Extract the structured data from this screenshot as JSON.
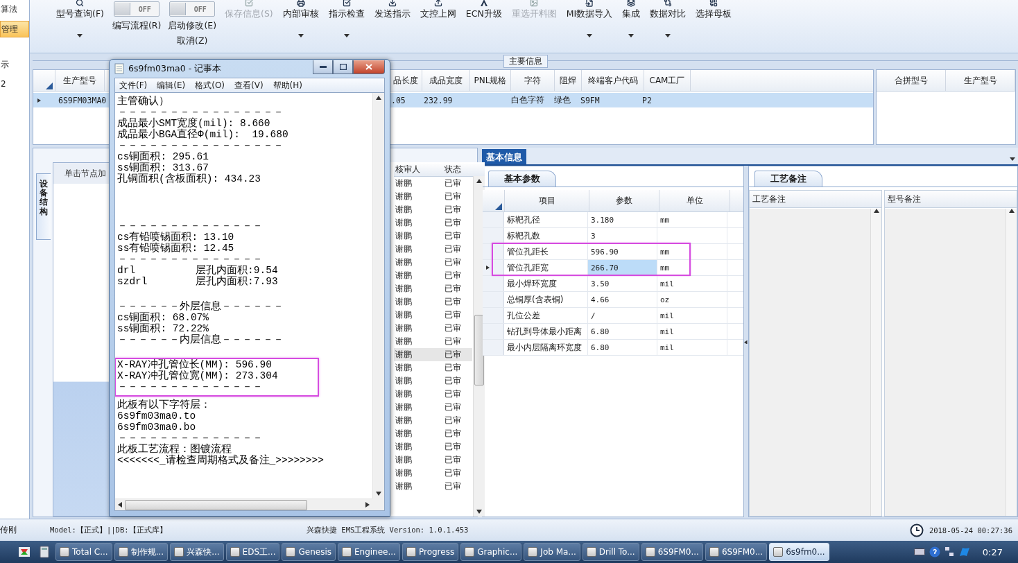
{
  "sidebar": {
    "items": [
      {
        "label": "算法",
        "selected": false
      },
      {
        "label": "管理",
        "selected": true
      },
      {
        "label": "示",
        "selected": false
      },
      {
        "label": "2",
        "selected": false
      }
    ]
  },
  "toolbar": {
    "items": [
      {
        "kind": "button",
        "label": "型号查询(F)",
        "disabled": false,
        "dropdown": true
      },
      {
        "kind": "toggle",
        "state_text": "OFF",
        "on": false,
        "label": "编写流程(R)"
      },
      {
        "kind": "toggle",
        "state_text": "OFF",
        "on": false,
        "label": "启动修改(E)",
        "sublabel": "取消(Z)"
      },
      {
        "kind": "button",
        "label": "保存信息(S)",
        "disabled": true,
        "dropdown": false
      },
      {
        "kind": "button",
        "label": "内部审核",
        "disabled": false,
        "dropdown": true
      },
      {
        "kind": "button",
        "label": "指示检查",
        "disabled": false,
        "dropdown": true
      },
      {
        "kind": "button",
        "label": "发送指示",
        "disabled": false,
        "dropdown": false
      },
      {
        "kind": "button",
        "label": "文控上网",
        "disabled": false,
        "dropdown": false
      },
      {
        "kind": "button",
        "label": "ECN升级",
        "disabled": false,
        "dropdown": false
      },
      {
        "kind": "button",
        "label": "重选开料图",
        "disabled": true,
        "dropdown": false
      },
      {
        "kind": "button",
        "label": "MI数据导入",
        "disabled": false,
        "dropdown": true
      },
      {
        "kind": "button",
        "label": "集成",
        "disabled": false,
        "dropdown": true
      },
      {
        "kind": "button",
        "label": "数据对比",
        "disabled": false,
        "dropdown": true
      },
      {
        "kind": "button",
        "label": "选择母板",
        "disabled": false,
        "dropdown": false
      }
    ]
  },
  "main_info": {
    "title": "主要信息",
    "columns": [
      "生产型号",
      "品长度",
      "成品宽度",
      "PNL规格",
      "字符",
      "阻焊",
      "终端客户代码",
      "CAM工厂"
    ],
    "rows": [
      {
        "selected": true,
        "cells": [
          "6S9FM03MA0",
          ".05",
          "232.99",
          null,
          "白色字符",
          "绿色",
          "S9FM",
          "P2"
        ]
      }
    ]
  },
  "merge_table": {
    "columns": [
      "合拼型号",
      "生产型号"
    ]
  },
  "tree_panel": {
    "tab_label": "设备结构",
    "header": "单击节点加"
  },
  "review_list": {
    "columns": [
      "核审人",
      "状态"
    ],
    "rows": [
      {
        "reviewer": "谢鹏",
        "status": "已审",
        "selected": false
      },
      {
        "reviewer": "谢鹏",
        "status": "已审",
        "selected": false
      },
      {
        "reviewer": "谢鹏",
        "status": "已审",
        "selected": false
      },
      {
        "reviewer": "谢鹏",
        "status": "已审",
        "selected": false
      },
      {
        "reviewer": "谢鹏",
        "status": "已审",
        "selected": false
      },
      {
        "reviewer": "谢鹏",
        "status": "已审",
        "selected": false
      },
      {
        "reviewer": "谢鹏",
        "status": "已审",
        "selected": false
      },
      {
        "reviewer": "谢鹏",
        "status": "已审",
        "selected": false
      },
      {
        "reviewer": "谢鹏",
        "status": "已审",
        "selected": false
      },
      {
        "reviewer": "谢鹏",
        "status": "已审",
        "selected": false
      },
      {
        "reviewer": "谢鹏",
        "status": "已审",
        "selected": false
      },
      {
        "reviewer": "谢鹏",
        "status": "已审",
        "selected": false
      },
      {
        "reviewer": "谢鹏",
        "status": "已审",
        "selected": false
      },
      {
        "reviewer": "谢鹏",
        "status": "已审",
        "selected": true
      },
      {
        "reviewer": "谢鹏",
        "status": "已审",
        "selected": false
      },
      {
        "reviewer": "谢鹏",
        "status": "已审",
        "selected": false
      },
      {
        "reviewer": "谢鹏",
        "status": "已审",
        "selected": false
      },
      {
        "reviewer": "谢鹏",
        "status": "已审",
        "selected": false
      },
      {
        "reviewer": "谢鹏",
        "status": "已审",
        "selected": false
      },
      {
        "reviewer": "谢鹏",
        "status": "已审",
        "selected": false
      },
      {
        "reviewer": "谢鹏",
        "status": "已审",
        "selected": false
      },
      {
        "reviewer": "谢鹏",
        "status": "已审",
        "selected": false
      },
      {
        "reviewer": "谢鹏",
        "status": "已审",
        "selected": false
      },
      {
        "reviewer": "谢鹏",
        "status": "已审",
        "selected": false
      }
    ]
  },
  "details": {
    "tab": "基本信息",
    "params": {
      "tab": "基本参数",
      "columns": [
        "项目",
        "参数",
        "单位"
      ],
      "rows": [
        {
          "item": "标靶孔径",
          "value": "3.180",
          "unit": "mm",
          "selected": false,
          "flagged": false
        },
        {
          "item": "标靶孔数",
          "value": "3",
          "unit": null,
          "selected": false,
          "flagged": false
        },
        {
          "item": "管位孔距长",
          "value": "596.90",
          "unit": "mm",
          "selected": false,
          "flagged": true
        },
        {
          "item": "管位孔距宽",
          "value": "266.70",
          "unit": "mm",
          "selected": true,
          "flagged": true
        },
        {
          "item": "最小焊环宽度",
          "value": "3.50",
          "unit": "mil",
          "selected": false,
          "flagged": false
        },
        {
          "item": "总铜厚(含表铜)",
          "value": "4.66",
          "unit": "oz",
          "selected": false,
          "flagged": false
        },
        {
          "item": "孔位公差",
          "value": "/",
          "unit": "mil",
          "selected": false,
          "flagged": false
        },
        {
          "item": "钻孔到导体最小距离",
          "value": "6.80",
          "unit": "mil",
          "selected": false,
          "flagged": false
        },
        {
          "item": "最小内层隔离环宽度",
          "value": "6.80",
          "unit": "mil",
          "selected": false,
          "flagged": false
        }
      ]
    },
    "notes": {
      "tab": "工艺备注",
      "columns": [
        "工艺备注",
        "型号备注"
      ]
    }
  },
  "notepad": {
    "title": "6s9fm03ma0 - 记事本",
    "menu": [
      "文件(F)",
      "编辑(E)",
      "格式(O)",
      "查看(V)",
      "帮助(H)"
    ],
    "blocks": [
      {
        "highlighted": false,
        "lines": [
          "主管确认）",
          "－－－－－－－－－－－－－－－－",
          "成品最小SMT宽度(mil): 8.660",
          "成品最小BGA直径Φ(mil):  19.680",
          "－－－－－－－－－－－－－－－－",
          "cs铜面积: 295.61",
          "ss铜面积: 313.67",
          "孔铜面积(含板面积): 434.23"
        ]
      },
      {
        "highlighted": false,
        "lines": [
          "－－－－－－－－－－－－－－",
          "cs有铅喷锡面积: 13.10",
          "ss有铅喷锡面积: 12.45",
          "－－－－－－－－－－－－－－",
          "drl          层孔内面积:9.54",
          "szdrl        层孔内面积:7.93"
        ]
      },
      {
        "highlighted": false,
        "lines": [
          "－－－－－－外层信息－－－－－－",
          "cs铜面积: 68.07%",
          "ss铜面积: 72.22%",
          "－－－－－－内层信息－－－－－－"
        ]
      },
      {
        "highlighted": true,
        "lines": [
          "X-RAY冲孔管位长(MM): 596.90",
          "X-RAY冲孔管位宽(MM): 273.304",
          "－－－－－－－－－－－－－－"
        ]
      },
      {
        "highlighted": false,
        "lines": [
          "此板有以下字符层：",
          "6s9fm03ma0.to",
          "6s9fm03ma0.bo",
          "－－－－－－－－－－－－－－",
          "此板工艺流程：图镀流程",
          "<<<<<<<_请检查周期格式及备注_>>>>>>>>"
        ]
      }
    ]
  },
  "status_bar": {
    "user": "传刚",
    "model": "Model:【正式】||DB:【正式库】",
    "app": "兴森快捷 EMS工程系统 Version: 1.0.1.453",
    "datetime": "2018-05-24 00:27:36"
  },
  "taskbar": {
    "items": [
      {
        "label": "Total C...",
        "selected": false
      },
      {
        "label": "制作规...",
        "selected": false
      },
      {
        "label": "兴森快...",
        "selected": false
      },
      {
        "label": "EDS工...",
        "selected": false
      },
      {
        "label": "Genesis",
        "selected": false
      },
      {
        "label": "Enginee...",
        "selected": false
      },
      {
        "label": "Progress",
        "selected": false
      },
      {
        "label": "Graphic...",
        "selected": false
      },
      {
        "label": "Job Ma...",
        "selected": false
      },
      {
        "label": "Drill To...",
        "selected": false
      },
      {
        "label": "6S9FM0...",
        "selected": false
      },
      {
        "label": "6S9FM0...",
        "selected": false
      },
      {
        "label": "6s9fm0...",
        "selected": true
      }
    ],
    "clock": "0:27"
  }
}
